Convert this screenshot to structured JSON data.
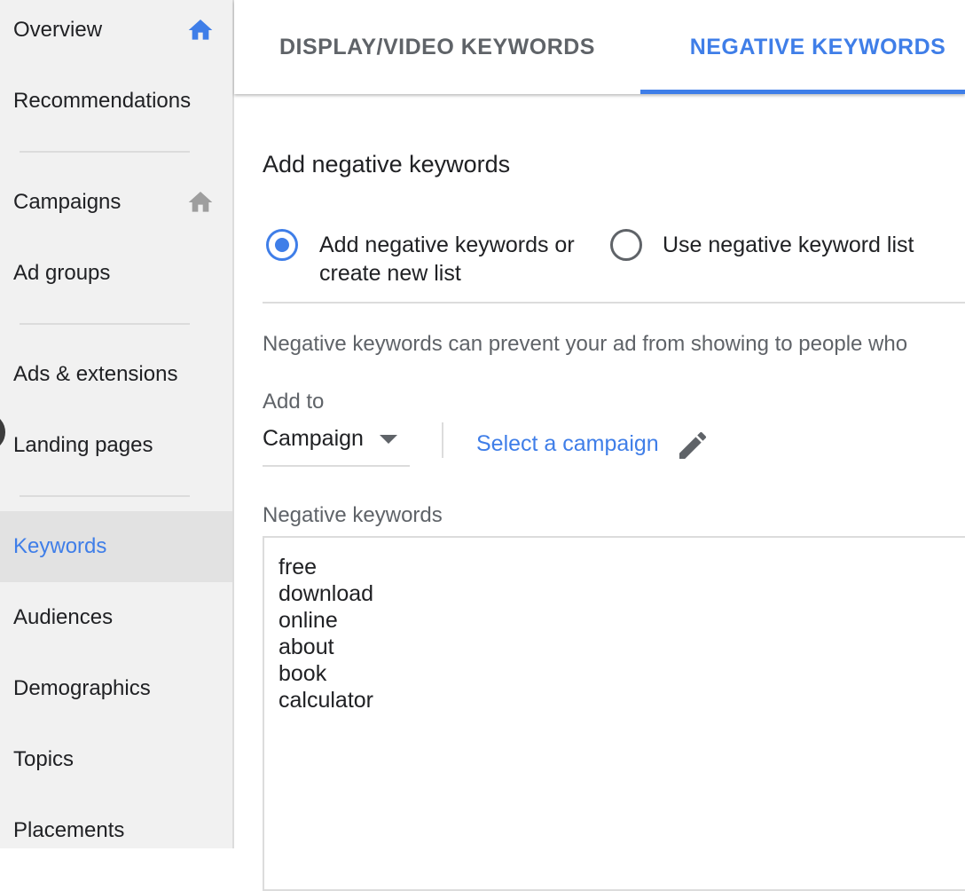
{
  "sidebar": {
    "items": [
      {
        "label": "Overview",
        "icon": "home-icon",
        "icon_color": "#3f7ee8"
      },
      {
        "label": "Recommendations"
      },
      {
        "label": "Campaigns",
        "icon": "home-icon",
        "icon_color": "#9e9e9e"
      },
      {
        "label": "Ad groups"
      },
      {
        "label": "Ads & extensions"
      },
      {
        "label": "Landing pages"
      },
      {
        "label": "Keywords",
        "active": true
      },
      {
        "label": "Audiences"
      },
      {
        "label": "Demographics"
      },
      {
        "label": "Topics"
      },
      {
        "label": "Placements"
      }
    ]
  },
  "tabs": [
    {
      "label": "DISPLAY/VIDEO KEYWORDS",
      "selected": false
    },
    {
      "label": "NEGATIVE KEYWORDS",
      "selected": true
    }
  ],
  "main": {
    "title": "Add negative keywords",
    "radio_options": [
      {
        "label": "Add negative keywords or create new list",
        "checked": true
      },
      {
        "label": "Use negative keyword list",
        "checked": false
      }
    ],
    "info_text": "Negative keywords can prevent your ad from showing to people who",
    "add_to_label": "Add to",
    "add_to_value": "Campaign",
    "select_campaign_link": "Select a campaign",
    "negative_keywords_label": "Negative keywords",
    "negative_keywords": [
      "free",
      "download",
      "online",
      "about",
      "book",
      "calculator"
    ]
  },
  "colors": {
    "accent": "#3f7ee8",
    "sidebar_bg": "#f1f1f1",
    "active_item_bg": "#e2e2e2",
    "secondary_text": "#5f6368"
  }
}
